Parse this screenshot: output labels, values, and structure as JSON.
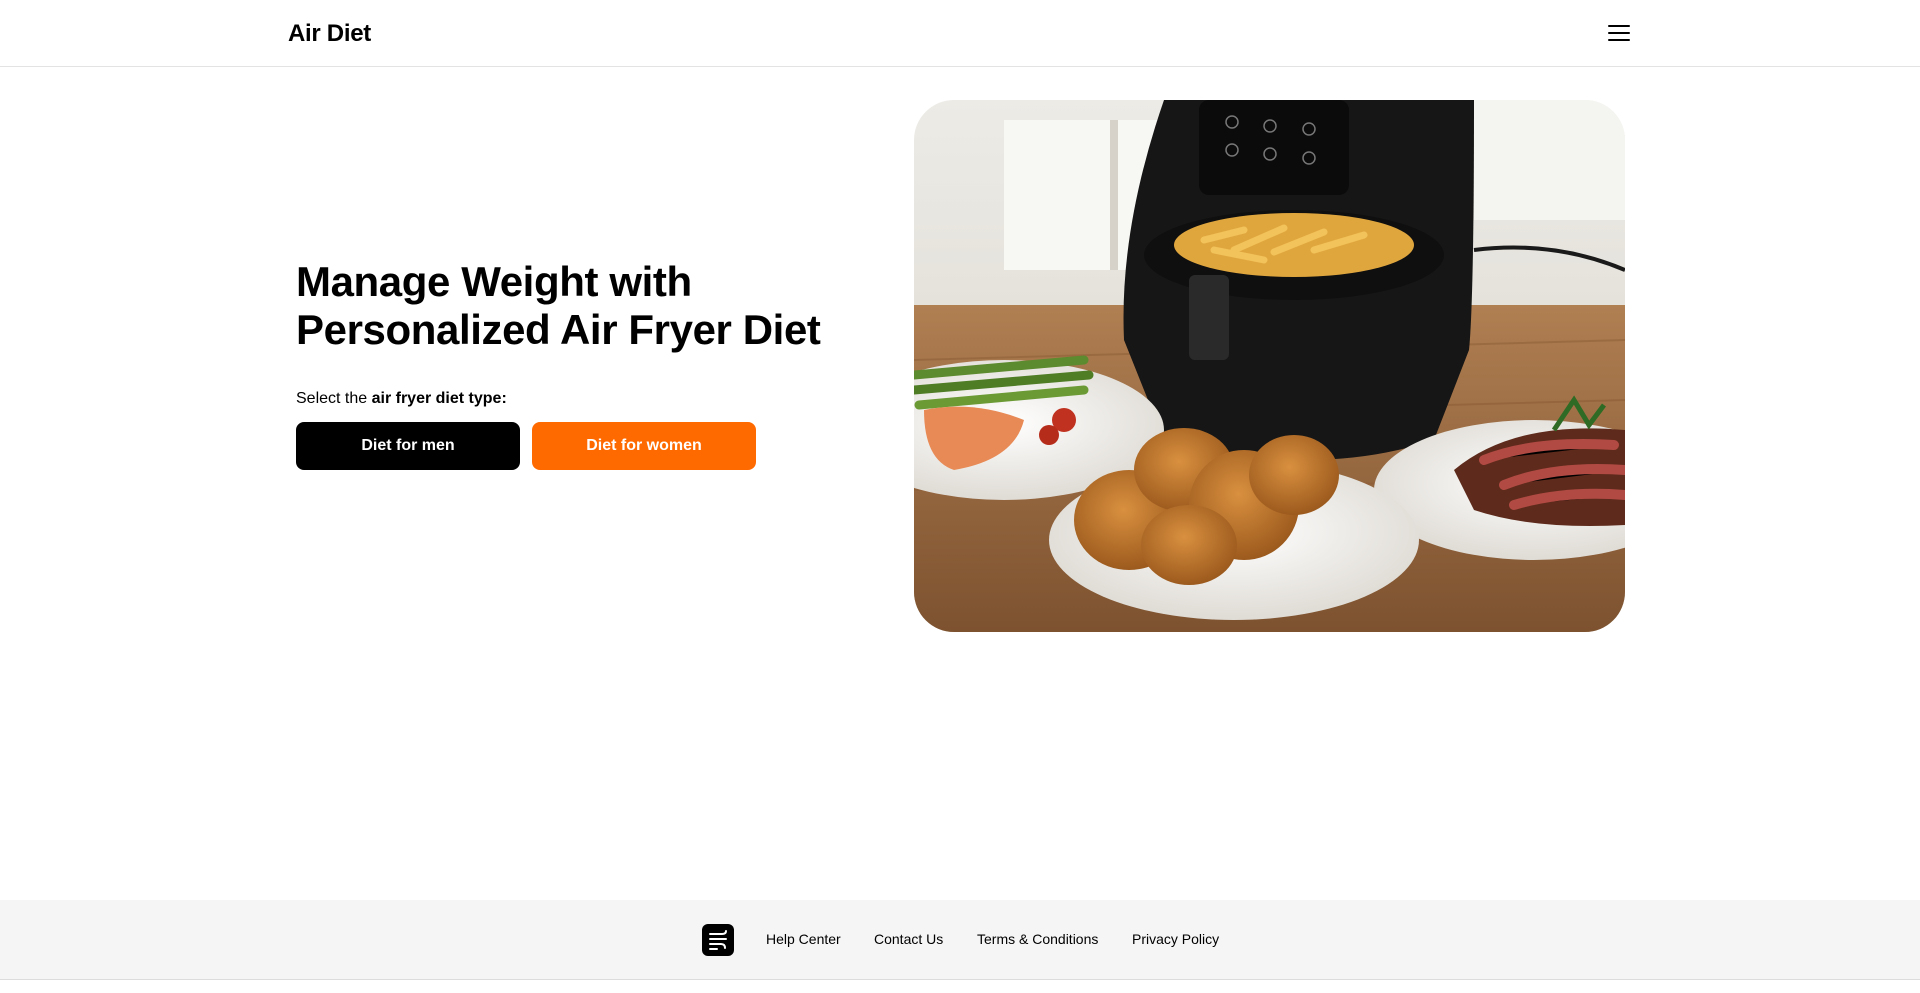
{
  "header": {
    "logo": "Air Diet",
    "menu_icon": "hamburger-menu-icon"
  },
  "hero": {
    "title": "Manage Weight with Personalized Air Fryer Diet",
    "subtitle_prefix": "Select the ",
    "subtitle_bold": "air fryer diet type:",
    "buttons": {
      "men": "Diet for men",
      "women": "Diet for women"
    },
    "image_icon": "air-fryer-food-photo"
  },
  "footer": {
    "logo_icon": "air-wind-logo-icon",
    "links": [
      "Help Center",
      "Contact Us",
      "Terms & Conditions",
      "Privacy Policy"
    ]
  },
  "colors": {
    "accent": "#ff6a00",
    "primary": "#000000",
    "footer_bg": "#f5f5f5"
  }
}
